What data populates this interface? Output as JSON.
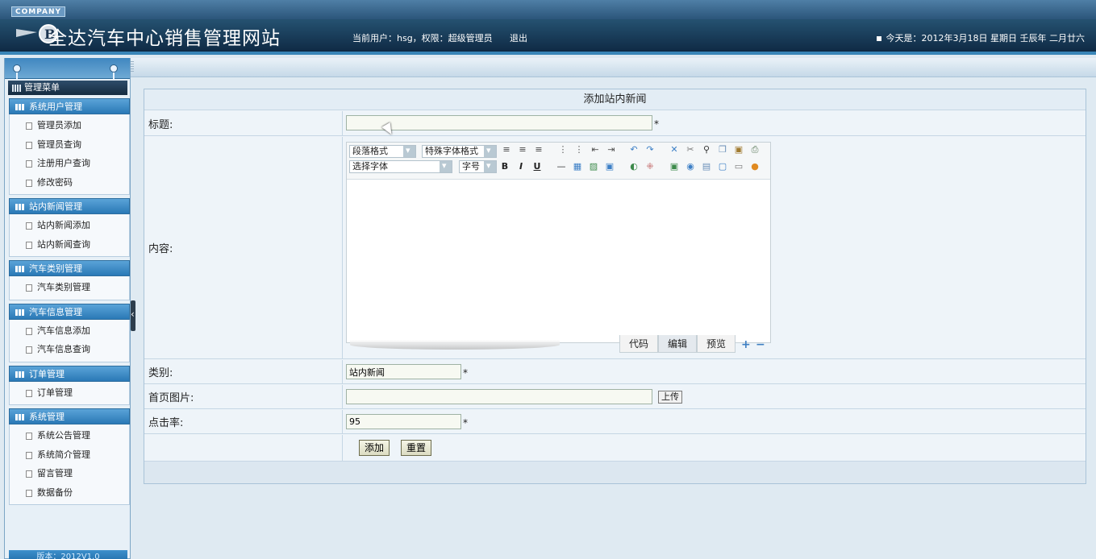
{
  "header": {
    "company_badge": "COMPANY",
    "site_title": "全达汽车中心销售管理网站",
    "user_info": "当前用户：hsg，权限：超级管理员",
    "logout": "退出",
    "today": "今天是：2012年3月18日 星期日 壬辰年 二月廿六"
  },
  "sidebar": {
    "menu_title": "管理菜单",
    "groups": [
      {
        "title": "系统用户管理",
        "items": [
          "管理员添加",
          "管理员查询",
          "注册用户查询",
          "修改密码"
        ]
      },
      {
        "title": "站内新闻管理",
        "items": [
          "站内新闻添加",
          "站内新闻查询"
        ]
      },
      {
        "title": "汽车类别管理",
        "items": [
          "汽车类别管理"
        ]
      },
      {
        "title": "汽车信息管理",
        "items": [
          "汽车信息添加",
          "汽车信息查询"
        ]
      },
      {
        "title": "订单管理",
        "items": [
          "订单管理"
        ]
      },
      {
        "title": "系统管理",
        "items": [
          "系统公告管理",
          "系统简介管理",
          "留言管理",
          "数据备份"
        ]
      }
    ],
    "version": "版本：2012V1.0"
  },
  "form": {
    "caption": "添加站内新闻",
    "title_label": "标题:",
    "title_value": "",
    "content_label": "内容:",
    "category_label": "类别:",
    "category_value": "站内新闻",
    "image_label": "首页图片:",
    "image_value": "",
    "upload_button": "上传",
    "clicks_label": "点击率:",
    "clicks_value": "95",
    "required_mark": "*",
    "submit_button": "添加",
    "reset_button": "重置"
  },
  "editor": {
    "paragraph_format": "段落格式",
    "special_format": "特殊字体格式",
    "font_family": "选择字体",
    "font_size": "字号",
    "bold": "B",
    "italic": "I",
    "underline": "U",
    "tabs": [
      "代码",
      "编辑",
      "预览"
    ],
    "active_tab": "编辑"
  }
}
